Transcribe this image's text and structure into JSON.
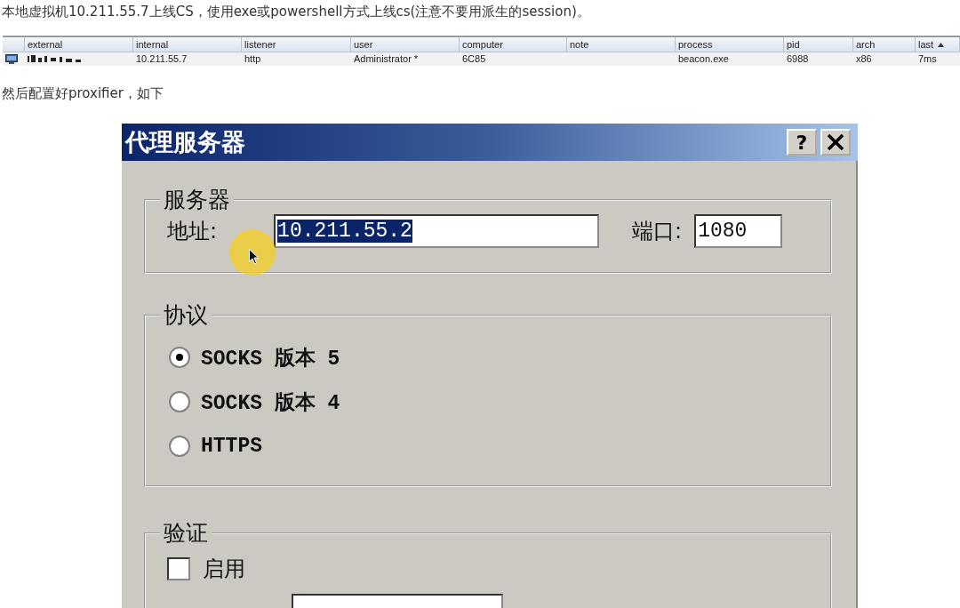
{
  "intro": "本地虚拟机10.211.55.7上线CS，使用exe或powershell方式上线cs(注意不要用派生的session)。",
  "table": {
    "columns": [
      {
        "label": "external",
        "sorted": false
      },
      {
        "label": "internal",
        "sorted": false
      },
      {
        "label": "listener",
        "sorted": false
      },
      {
        "label": "user",
        "sorted": false
      },
      {
        "label": "computer",
        "sorted": false
      },
      {
        "label": "note",
        "sorted": false
      },
      {
        "label": "process",
        "sorted": false
      },
      {
        "label": "pid",
        "sorted": false
      },
      {
        "label": "arch",
        "sorted": false
      },
      {
        "label": "last",
        "sorted": true
      }
    ],
    "rows": [
      {
        "cells": [
          {
            "kind": "redacted"
          },
          {
            "kind": "text",
            "text": "10.211.55.7"
          },
          {
            "kind": "text",
            "text": "http"
          },
          {
            "kind": "text",
            "text": "Administrator *"
          },
          {
            "kind": "text",
            "text": "6C85"
          },
          {
            "kind": "empty"
          },
          {
            "kind": "text",
            "text": "beacon.exe"
          },
          {
            "kind": "text",
            "text": "6988"
          },
          {
            "kind": "text",
            "text": "x86"
          },
          {
            "kind": "text",
            "text": "7ms"
          }
        ]
      }
    ]
  },
  "note": "然后配置好proxifier，如下",
  "dialog": {
    "title": "代理服务器",
    "help_button": "?",
    "server": {
      "legend": "服务器",
      "address_label": "地址:",
      "address_value": "10.211.55.2",
      "address_selected": true,
      "port_label": "端口:",
      "port_value": "1080"
    },
    "protocol": {
      "legend": "协议",
      "options": [
        {
          "label": "SOCKS 版本 5",
          "selected": true
        },
        {
          "label": "SOCKS 版本 4",
          "selected": false
        },
        {
          "label": "HTTPS",
          "selected": false
        }
      ]
    },
    "auth": {
      "legend": "验证",
      "enable_label": "启用",
      "enable_checked": false
    }
  }
}
